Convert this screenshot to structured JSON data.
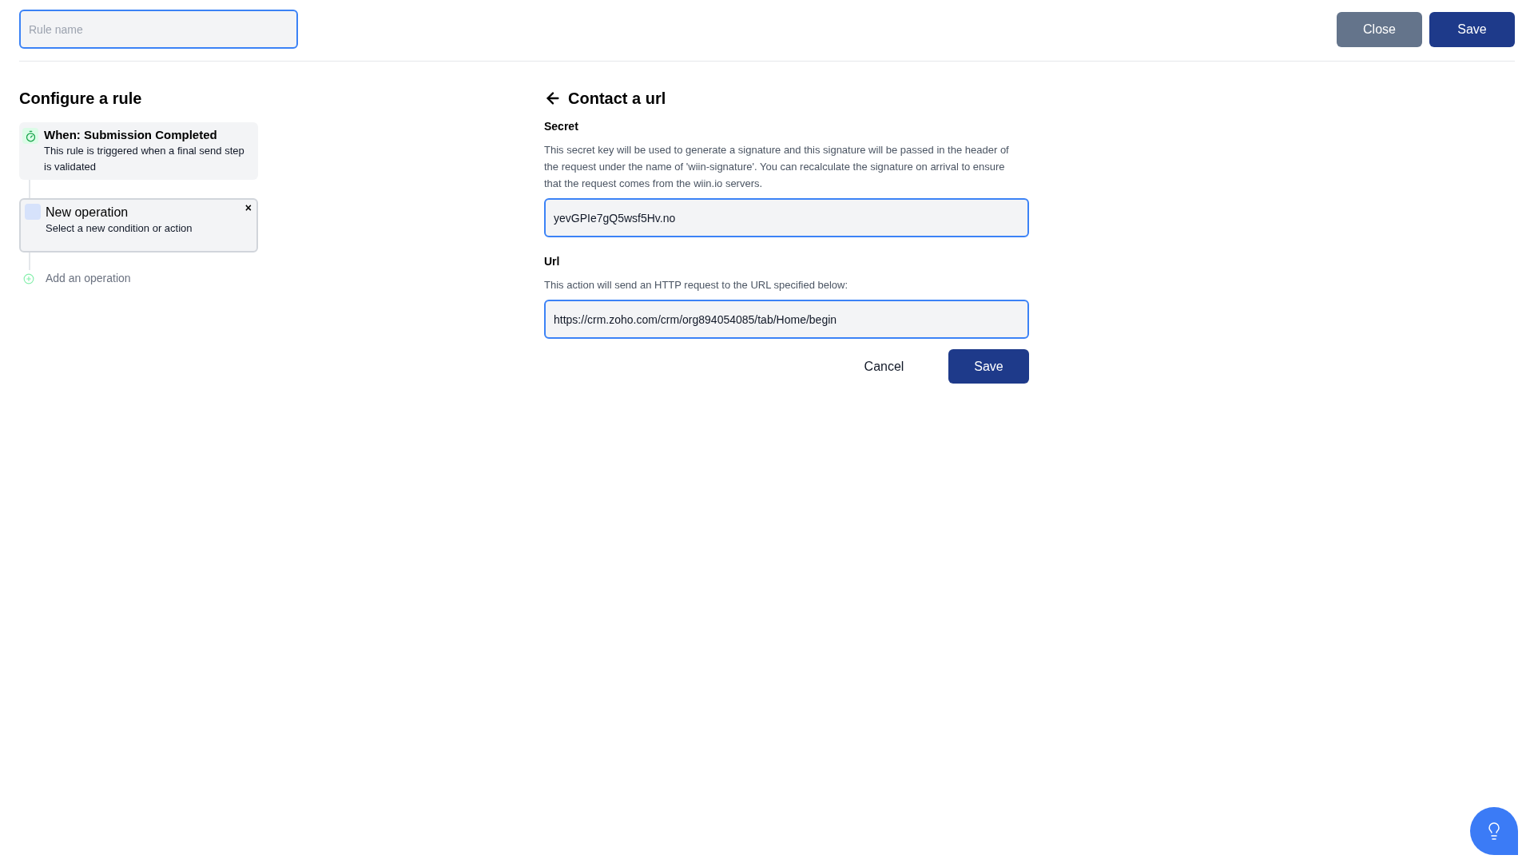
{
  "header": {
    "rule_name": {
      "placeholder": "Rule name"
    },
    "buttons": [
      {
        "label": "Close",
        "kind": "secondary"
      },
      {
        "label": "Save",
        "kind": "primary"
      }
    ]
  },
  "rule": {
    "title": "Configure a rule",
    "steps": [
      {
        "kind": "trigger",
        "title": "When: Submission Completed",
        "description": "This rule is triggered when a final send step is validated"
      },
      {
        "kind": "operation",
        "title": "New operation",
        "description": "Select a new condition or action",
        "close": "×"
      }
    ],
    "add_label": "Add an operation"
  },
  "panel": {
    "title": "Contact a url",
    "fields": [
      {
        "label": "Secret",
        "help": "This secret key will be used to generate a signature and this signature will be passed in the header of the request under the name of 'wiin-signature'. You can recalculate the signature on arrival to ensure that the request comes from the wiin.io servers.",
        "value": "yevGPIe7gQ5wsf5Hv.no"
      },
      {
        "label": "Url",
        "help": "This action will send an HTTP request to the URL specified below:",
        "value": "https://crm.zoho.com/crm/org894054085/tab/Home/begin"
      }
    ],
    "buttons": [
      {
        "label": "Cancel",
        "kind": "text"
      },
      {
        "label": "Save",
        "kind": "primary"
      }
    ]
  }
}
